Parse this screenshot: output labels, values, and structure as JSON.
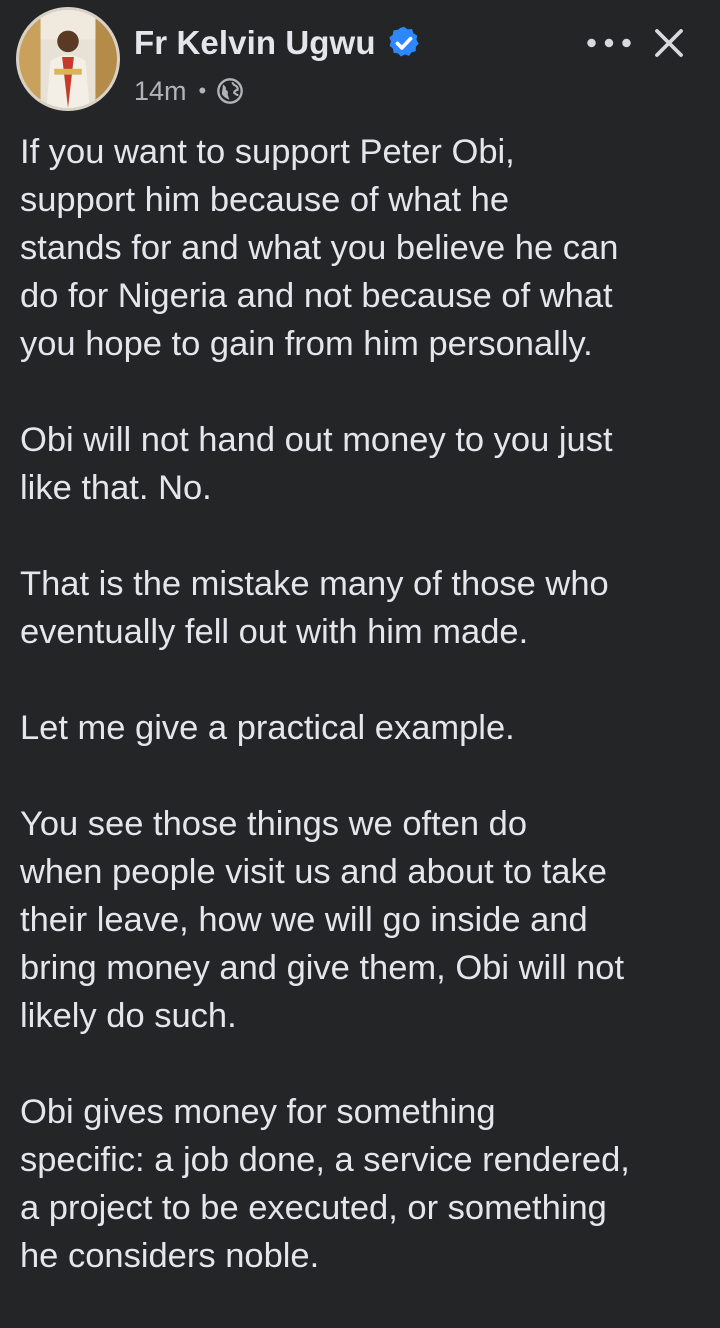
{
  "post": {
    "author": {
      "name": "Fr Kelvin Ugwu",
      "verified": true,
      "avatar_icon": "avatar-photo"
    },
    "timestamp": "14m",
    "separator": "•",
    "audience_icon": "globe-icon",
    "actions": {
      "more_icon": "more-horizontal-icon",
      "close_icon": "close-icon"
    },
    "paragraphs": [
      "If you want to support Peter Obi,\nsupport him because of what he\nstands for and what you believe he can\ndo for Nigeria and not because of what\nyou hope to gain from him personally.",
      "Obi will not hand out money to you just\nlike that. No.",
      "That is the mistake many of those who\neventually fell out with him made.",
      "Let me give a practical example.",
      "You see those things we often do\nwhen people visit us and about to take\ntheir leave, how we will go inside and\nbring money and give them, Obi will not\nlikely do such.",
      "Obi gives money for something\nspecific: a job done, a service rendered,\na project to be executed, or something\nhe considers noble."
    ]
  },
  "colors": {
    "background": "#242526",
    "primary_text": "#e4e6eb",
    "secondary_text": "#b0b3b8",
    "verified_badge": "#2d88ff"
  }
}
